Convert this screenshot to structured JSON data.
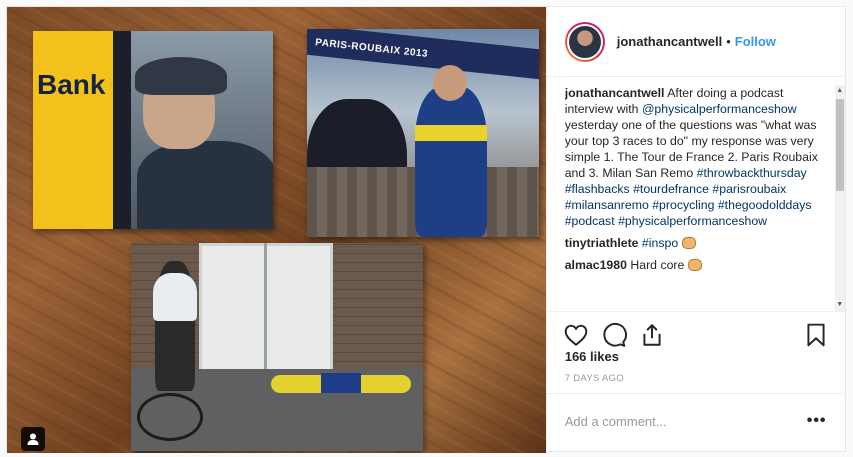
{
  "post": {
    "username": "jonathancantwell",
    "follow_label": "Follow",
    "separator": "•",
    "caption_user": "jonathancantwell",
    "caption_text_1": " After doing a podcast interview with ",
    "caption_mention": "@physicalperformanceshow",
    "caption_text_2": " yesterday one of the questions was \"what was your top 3 races to do\" my response was very simple 1. The Tour de France 2. Paris Roubaix and 3. Milan San Remo ",
    "hashtags": [
      "#throwbackthursday",
      "#flashbacks",
      "#tourdefrance",
      "#parisroubaix",
      "#milansanremo",
      "#procycling",
      "#thegoodolddays",
      "#podcast",
      "#physicalperformanceshow"
    ],
    "comments": [
      {
        "user": "tinytriathlete",
        "text": " #inspo",
        "emoji": "raising-hands"
      },
      {
        "user": "almac1980",
        "text": " Hard core",
        "emoji": "flexed-biceps"
      }
    ],
    "likes": "166 likes",
    "timestamp": "7 DAYS AGO",
    "add_comment_placeholder": "Add a comment...",
    "more_label": "•••"
  },
  "photo": {
    "print_1_sign": "Bank",
    "print_2_banner": "PARIS-ROUBAIX 2013",
    "tag_icon": "user-tag-icon"
  },
  "icons": {
    "like": "heart-icon",
    "comment": "comment-icon",
    "share": "share-icon",
    "save": "bookmark-icon"
  },
  "colors": {
    "link": "#3897f0",
    "hashtag": "#003569",
    "muted": "#999999"
  }
}
